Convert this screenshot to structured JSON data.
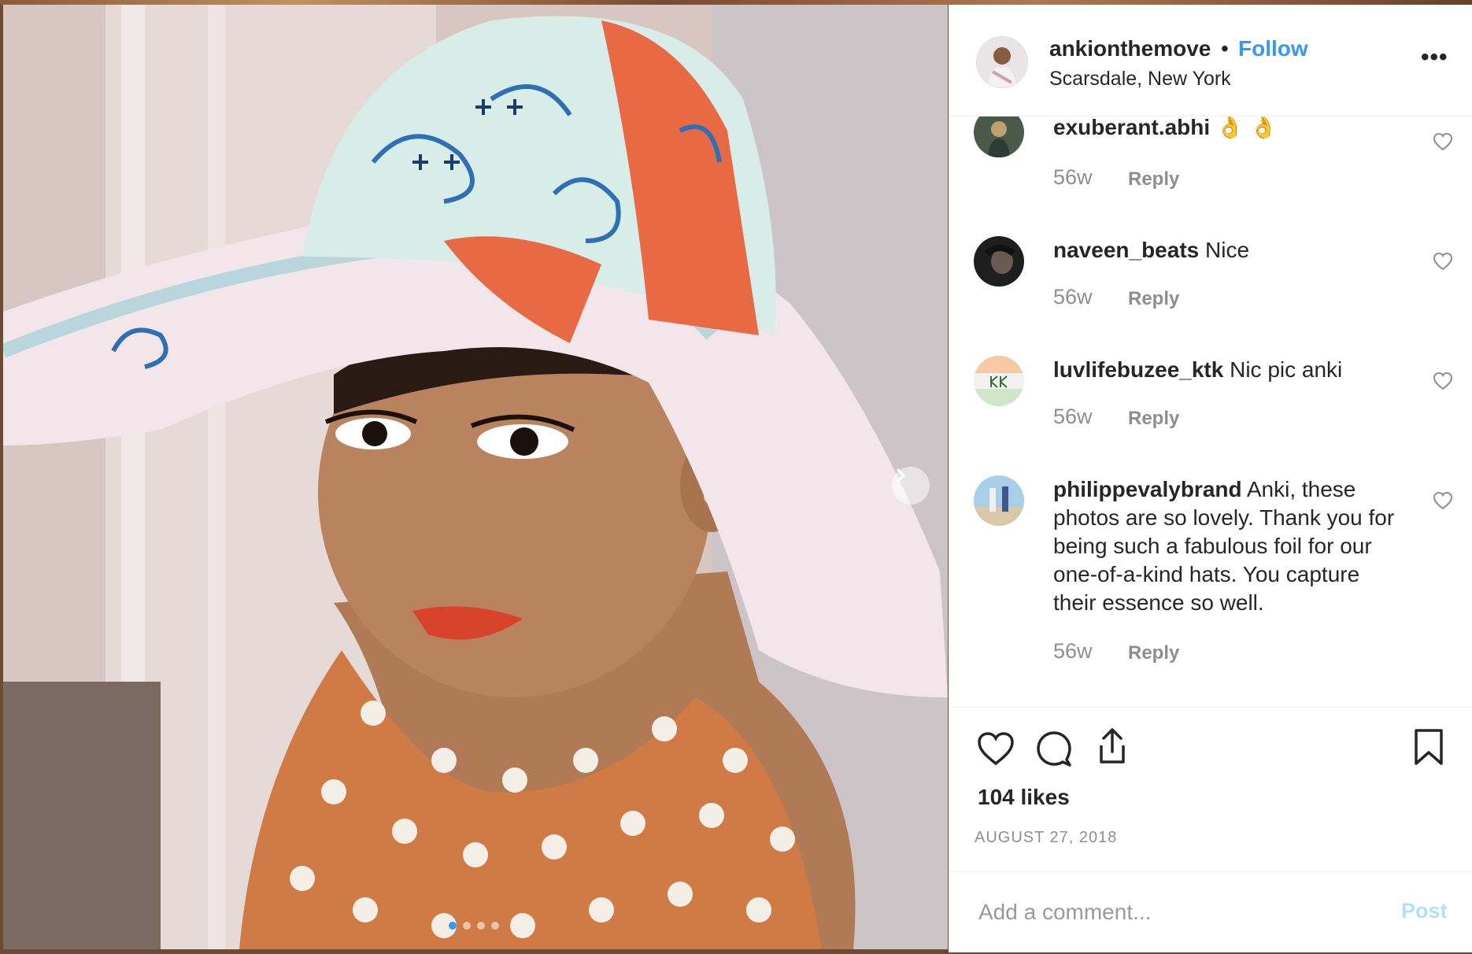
{
  "post": {
    "username": "ankionthemove",
    "separator": "•",
    "follow_label": "Follow",
    "location": "Scarsdale, New York",
    "more_label": "•••"
  },
  "comments": [
    {
      "username": "exuberant.abhi",
      "text": "👌 👌",
      "age": "56w",
      "reply": "Reply"
    },
    {
      "username": "naveen_beats",
      "text": "Nice",
      "age": "56w",
      "reply": "Reply"
    },
    {
      "username": "luvlifebuzee_ktk",
      "text": "Nic pic anki",
      "age": "56w",
      "reply": "Reply"
    },
    {
      "username": "philippevalybrand",
      "text": "Anki, these photos are so lovely. Thank you for being such a fabulous foil for our one-of-a-kind hats. You capture their essence so well.",
      "age": "56w",
      "reply": "Reply"
    }
  ],
  "actions": {
    "likes": "104 likes",
    "date": "AUGUST 27, 2018"
  },
  "comment_box": {
    "placeholder": "Add a comment...",
    "post_label": "Post"
  },
  "carousel": {
    "slides": 4,
    "active": 1
  },
  "colors": {
    "accent": "#3897f0",
    "post_disabled": "#b2dffc",
    "muted": "#8e8e8e"
  }
}
